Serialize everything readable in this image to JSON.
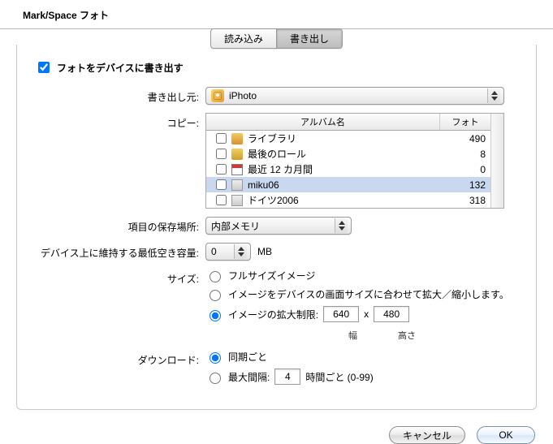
{
  "window_title": "Mark/Space フォト",
  "tabs": {
    "import": "読み込み",
    "export": "書き出し"
  },
  "export_checkbox_label": "フォトをデバイスに書き出す",
  "labels": {
    "source": "書き出し元:",
    "copy": "コピー:",
    "store": "項目の保存場所:",
    "min_free": "デバイス上に維持する最低空き容量:",
    "size": "サイズ:",
    "download": "ダウンロード:"
  },
  "source_popup": "iPhoto",
  "table": {
    "col_name": "アルバム名",
    "col_count": "フォト",
    "rows": [
      {
        "name": "ライブラリ",
        "count": 490,
        "icon": "lib-ic"
      },
      {
        "name": "最後のロール",
        "count": 8,
        "icon": "roll-ic"
      },
      {
        "name": "最近 12 カ月間",
        "count": 0,
        "icon": "cal-ic"
      },
      {
        "name": "miku06",
        "count": 132,
        "icon": "book-ic",
        "selected": true
      },
      {
        "name": "ドイツ2006",
        "count": 318,
        "icon": "book-ic"
      }
    ]
  },
  "store_popup": "内部メモリ",
  "min_free": {
    "value": "0",
    "unit": "MB"
  },
  "size_options": {
    "full": "フルサイズイメージ",
    "fit": "イメージをデバイスの画面サイズに合わせて拡大／縮小します。",
    "limit": "イメージの拡大制限:",
    "width": "640",
    "height": "480",
    "x": "x",
    "width_label": "幅",
    "height_label": "高さ"
  },
  "download_options": {
    "per_sync": "同期ごと",
    "max_interval": "最大間隔:",
    "interval_value": "4",
    "interval_suffix": "時間ごと (0-99)"
  },
  "buttons": {
    "cancel": "キャンセル",
    "ok": "OK"
  }
}
